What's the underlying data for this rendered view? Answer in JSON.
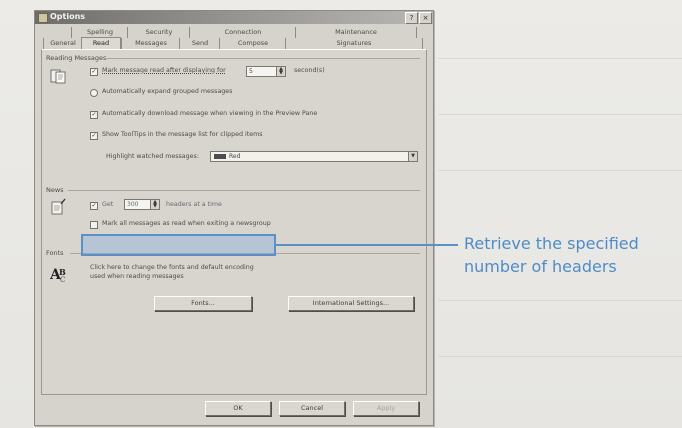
{
  "window": {
    "title": "Options",
    "help_glyph": "?",
    "close_glyph": "×"
  },
  "tabs": {
    "row1": [
      "Spelling",
      "Security",
      "Connection",
      "Maintenance"
    ],
    "row2": [
      "General",
      "Read",
      "Messages",
      "Send",
      "Compose",
      "Signatures"
    ],
    "active": "Read"
  },
  "reading": {
    "group_label": "Reading Messages",
    "mark_read_label": "Mark message read after displaying for",
    "mark_read_value": "5",
    "mark_read_unit": "second(s)",
    "auto_expand_label": "Automatically expand grouped messages",
    "auto_download_label": "Automatically download message when viewing in the Preview Pane",
    "tooltips_label": "Show ToolTips in the message list for clipped items",
    "highlight_label": "Highlight watched messages:",
    "highlight_value": "Red"
  },
  "news": {
    "group_label": "News",
    "get_label": "Get",
    "get_value": "300",
    "headers_label": "headers at a time",
    "mark_all_label": "Mark all messages as read when exiting a newsgroup"
  },
  "fonts": {
    "group_label": "Fonts",
    "desc_line1": "Click here to change the fonts and default encoding",
    "desc_line2": "used when reading messages",
    "fonts_button": "Fonts...",
    "intl_button": "International Settings..."
  },
  "footer": {
    "ok": "OK",
    "cancel": "Cancel",
    "apply": "Apply"
  },
  "callout": {
    "line1": "Retrieve the specified",
    "line2": "number of headers",
    "color": "#4e8cc8"
  }
}
